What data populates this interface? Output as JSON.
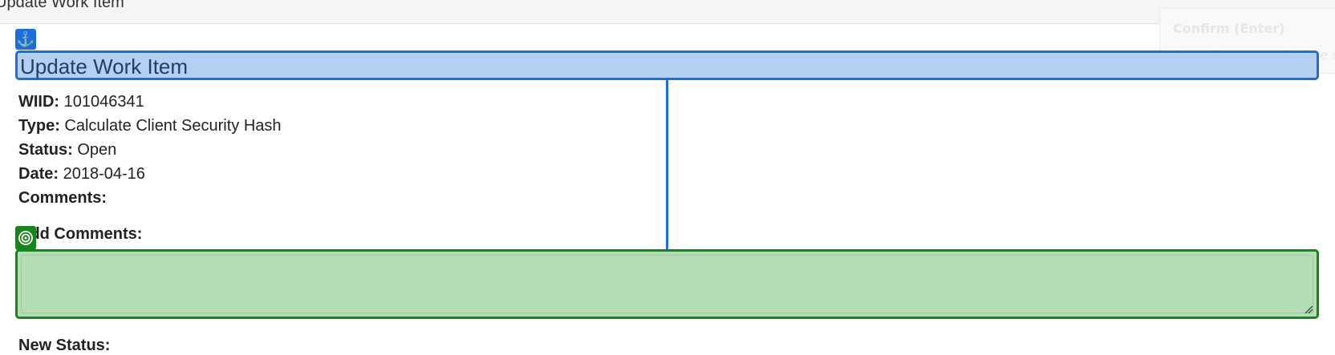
{
  "window": {
    "title": "Update Work Item"
  },
  "tooltip": {
    "title": "Confirm (Enter)",
    "body": "Save changes and close s"
  },
  "form": {
    "heading": "Update Work Item",
    "fields": [
      {
        "label": "WIID:",
        "value": "101046341"
      },
      {
        "label": "Type:",
        "value": "Calculate Client Security Hash"
      },
      {
        "label": "Status:",
        "value": "Open"
      },
      {
        "label": "Date:",
        "value": "2018-04-16"
      },
      {
        "label": "Comments:",
        "value": ""
      }
    ],
    "add_comments_label": "Add Comments:",
    "add_comments_value": "",
    "new_status_label": "New Status:"
  },
  "overlay": {
    "anchor_badge_icon": "anchor-icon",
    "target_badge_icon": "target-icon",
    "anchor_color": "#1a6fd8",
    "target_color": "#16861b"
  }
}
